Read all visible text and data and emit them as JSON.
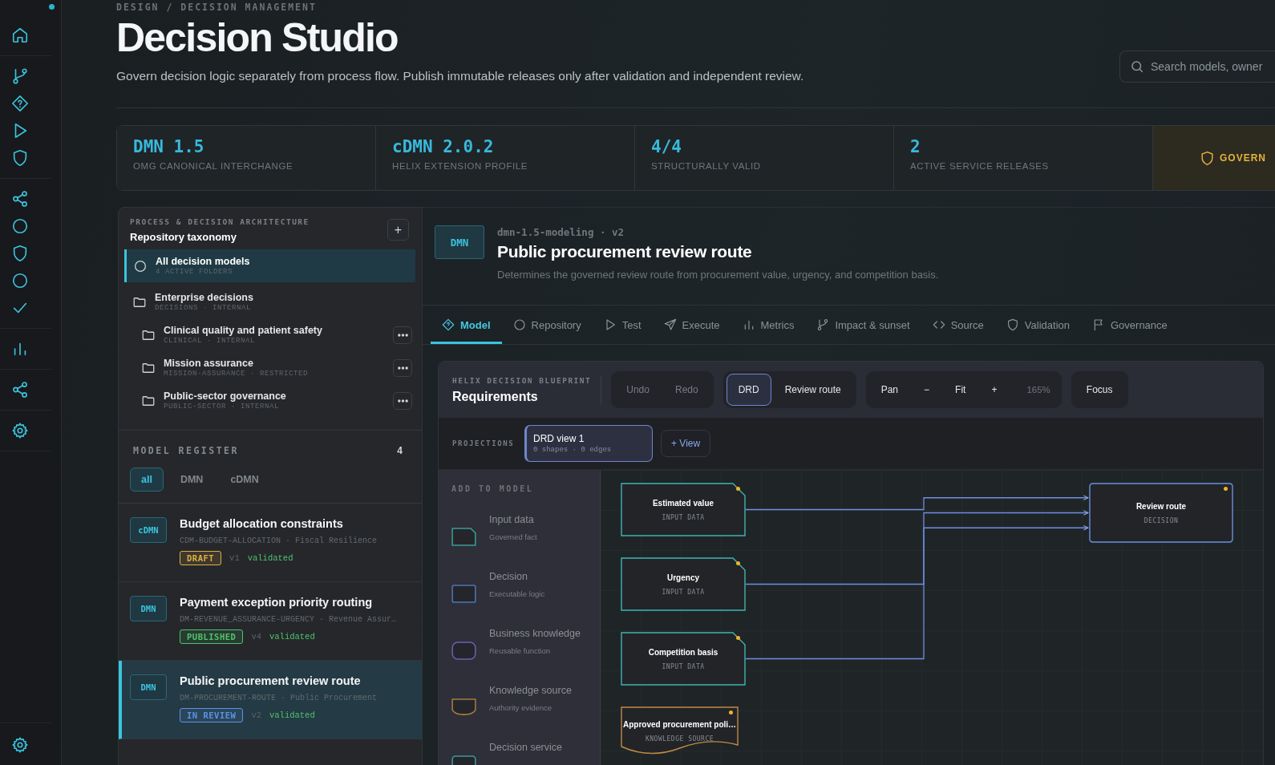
{
  "header": {
    "breadcrumb": "DESIGN / DECISION MANAGEMENT",
    "title": "Decision Studio",
    "subtitle": "Govern decision logic separately from process flow. Publish immutable releases only after validation and independent review.",
    "search": {
      "placeholder": "Search models, owner"
    }
  },
  "stats": [
    {
      "kind": "metric",
      "value": "DMN 1.5",
      "label": "OMG CANONICAL INTERCHANGE"
    },
    {
      "kind": "metric",
      "value": "cDMN 2.0.2",
      "label": "HELIX EXTENSION PROFILE"
    },
    {
      "kind": "metric",
      "value": "4/4",
      "label": "STRUCTURALLY VALID"
    },
    {
      "kind": "metric",
      "value": "2",
      "label": "ACTIVE SERVICE RELEASES"
    },
    {
      "kind": "governance",
      "value": "GOVERN"
    }
  ],
  "taxonomy": {
    "eyebrow": "PROCESS & DECISION ARCHITECTURE",
    "title": "Repository taxonomy",
    "add_button": "+",
    "items": [
      {
        "kind": "all",
        "name": "All decision models",
        "meta": "4 ACTIVE FOLDERS",
        "selected": true
      },
      {
        "kind": "folder",
        "name": "Enterprise decisions",
        "meta": "DECISIONS · INTERNAL",
        "selected": false,
        "children": [
          {
            "kind": "folder",
            "name": "Clinical quality and patient safety",
            "meta": "CLINICAL · INTERNAL",
            "selected": false
          },
          {
            "kind": "folder",
            "name": "Mission assurance",
            "meta": "MISSION-ASSURANCE · RESTRICTED",
            "selected": false
          },
          {
            "kind": "folder",
            "name": "Public-sector governance",
            "meta": "PUBLIC-SECTOR · INTERNAL",
            "selected": false
          }
        ]
      }
    ]
  },
  "register": {
    "title": "MODEL REGISTER",
    "count": "4",
    "filters": [
      {
        "label": "all",
        "selected": true
      },
      {
        "label": "DMN",
        "selected": false
      },
      {
        "label": "cDMN",
        "selected": false
      }
    ],
    "models": [
      {
        "type": "cDMN",
        "title": "Budget allocation constraints",
        "code": "CDM-BUDGET-ALLOCATION · Fiscal Resilience",
        "status": {
          "label": "DRAFT",
          "color": "#e0b040"
        },
        "version": "v1",
        "validation": "validated",
        "selected": false
      },
      {
        "type": "DMN",
        "title": "Payment exception priority routing",
        "code": "DM-REVENUE_ASSURANCE-URGENCY · Revenue Assur…",
        "status": {
          "label": "PUBLISHED",
          "color": "#4cc66a"
        },
        "version": "v4",
        "validation": "validated",
        "selected": false
      },
      {
        "type": "DMN",
        "title": "Public procurement review route",
        "code": "DM-PROCUREMENT-ROUTE · Public Procurement",
        "status": {
          "label": "IN REVIEW",
          "color": "#5b93e8"
        },
        "version": "v2",
        "validation": "validated",
        "selected": true
      }
    ]
  },
  "detail": {
    "badge": "DMN",
    "meta": "dmn-1.5-modeling · v2",
    "title": "Public procurement review route",
    "description": "Determines the governed review route from procurement value, urgency, and competition basis."
  },
  "tabs": [
    {
      "label": "Model",
      "selected": true
    },
    {
      "label": "Repository",
      "selected": false
    },
    {
      "label": "Test",
      "selected": false
    },
    {
      "label": "Execute",
      "selected": false
    },
    {
      "label": "Metrics",
      "selected": false
    },
    {
      "label": "Impact & sunset",
      "selected": false
    },
    {
      "label": "Source",
      "selected": false
    },
    {
      "label": "Validation",
      "selected": false
    },
    {
      "label": "Governance",
      "selected": false
    }
  ],
  "blueprint": {
    "eyebrow": "HELIX DECISION BLUEPRINT",
    "title": "Requirements",
    "history": [
      {
        "label": "Undo",
        "disabled": true
      },
      {
        "label": "Redo",
        "disabled": true
      }
    ],
    "views": [
      {
        "label": "DRD",
        "selected": true
      },
      {
        "label": "Review route",
        "selected": false
      }
    ],
    "navigation": [
      "Pan",
      "−",
      "Fit",
      "+"
    ],
    "zoom": "165%",
    "focus": "Focus",
    "projections": {
      "label": "PROJECTIONS",
      "views": [
        {
          "name": "DRD view 1",
          "meta": "0 shapes · 0 edges",
          "selected": true
        }
      ],
      "add_button": "+ View"
    },
    "palette": {
      "title": "ADD TO MODEL",
      "items": [
        {
          "kind": "input_data",
          "label": "Input data",
          "hint": "Governed fact"
        },
        {
          "kind": "decision",
          "label": "Decision",
          "hint": "Executable logic"
        },
        {
          "kind": "business_knowledge",
          "label": "Business knowledge",
          "hint": "Reusable function"
        },
        {
          "kind": "knowledge_source",
          "label": "Knowledge source",
          "hint": "Authority evidence"
        },
        {
          "kind": "decision_service",
          "label": "Decision service"
        }
      ]
    },
    "diagram": {
      "nodes": [
        {
          "kind": "input_data",
          "label": "Estimated value",
          "type_label": "INPUT DATA",
          "pending": true
        },
        {
          "kind": "input_data",
          "label": "Urgency",
          "type_label": "INPUT DATA",
          "pending": true
        },
        {
          "kind": "input_data",
          "label": "Competition basis",
          "type_label": "INPUT DATA",
          "pending": true
        },
        {
          "kind": "knowledge_source",
          "label": "Approved procurement poli…",
          "type_label": "KNOWLEDGE SOURCE",
          "pending": true
        },
        {
          "kind": "decision",
          "label": "Review route",
          "type_label": "DECISION",
          "pending": true
        }
      ]
    }
  }
}
